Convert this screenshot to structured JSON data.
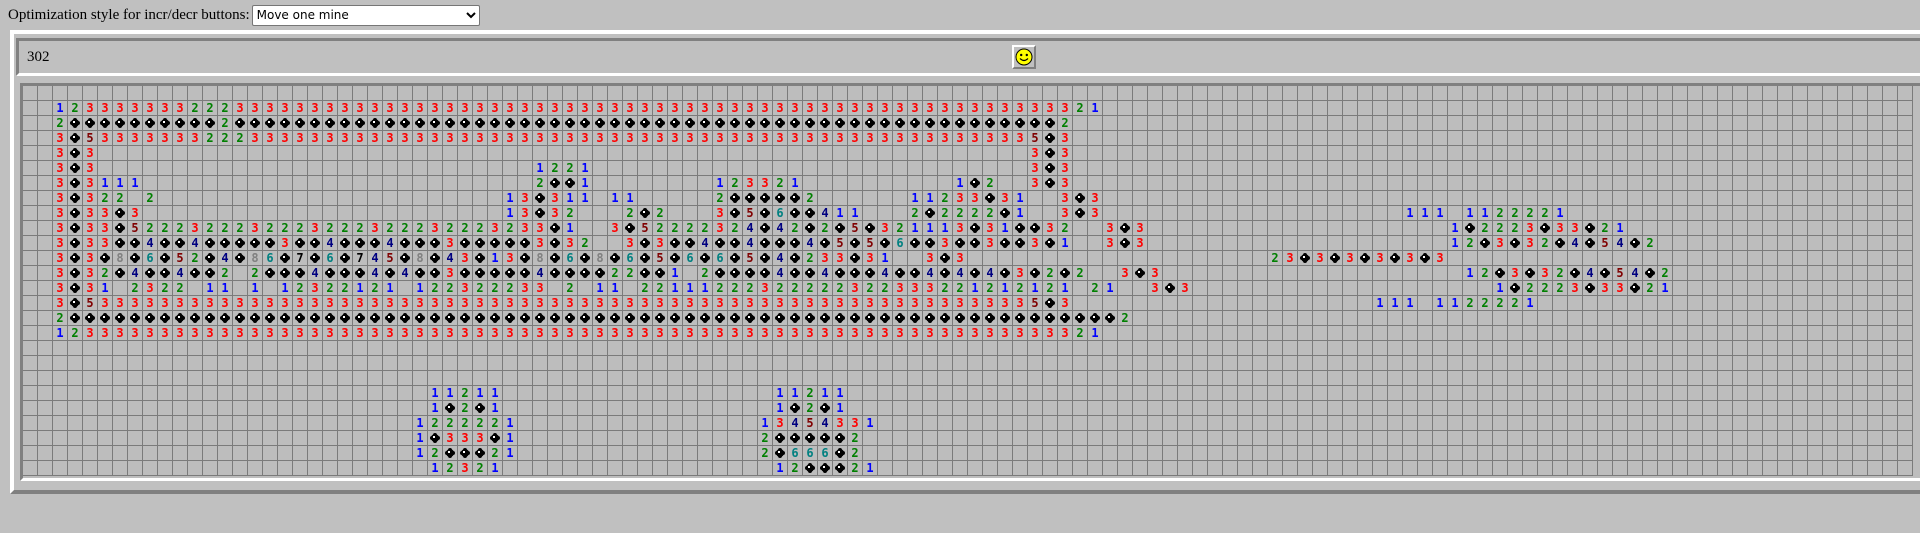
{
  "toolbar": {
    "label": "Optimization style for incr/decr buttons:",
    "selected_option": "Move one mine"
  },
  "header": {
    "mine_count": "302",
    "face": "smiley-face-icon"
  },
  "colors": {
    "1": "#0000ff",
    "2": "#008000",
    "3": "#ff0000",
    "4": "#000080",
    "5": "#800000",
    "6": "#008080",
    "7": "#000000",
    "8": "#808080"
  },
  "board": {
    "legend": "Rows list revealed cells only: '.' empty, digits = neighbor mine count, '*' = mine; first character = column 0",
    "rows": [
      "",
      "  1233333332223333333333333333333333333333333333333333333333333333333321",
      "  2**********2*******************************************************2",
      "  3*5333333322233333333333333333333333333333333333333333333333333335*3",
      "  3*3                                                              3*3",
      "  3*3                             1221                             3*3",
      "  3*3111                          2**1        123321          1*2  3*3",
      "  3*322 2                       13*311 11     2*****2      11233*31  3*3",
      "  3*33*3                        13*32   2*2   3*5*6**411   2*2222*1  3*3                    111 1122221",
      "  3*33*5222322232223222322232223233*1  3*52222324*42*2*5*321113*31**32  3*3                    1*2223*33*21",
      "  3*33**4**4*****3**4***4***3*****3*32  3*3**4**4***4*5*5*6**3**3**3*1  3*3                    12*3*32*4*54*2",
      "  3*3*8*6*52*4*86*7*6*745*8*43*13*8*6*8*6*5*6*6*5*4*233*31  3*3                    23*3*3*3*3*3",
      "  3*32*4**4**2 2***4***4*4**3*****4****22**1 2****4**4***4**4*4*4*3*2*2  3*3                    12*3*32*4*54*2",
      "  3*31 2322 11 1 12322121 122322233 2 11 22111222322222322333221212121 21  3*3                    1*2223*33*21",
      "  3*5333333333333333333333333333333333333333333333333333333333333335*3                    111 1122221",
      "  2**********************************************************************2",
      "  1233333333333333333333333333333333333333333333333333333333333333333321",
      "",
      "",
      "",
      "                           11211                  11211",
      "                           1*2*1                  1*2*1",
      "                          1222221                13454331",
      "                          1*333*1                2*****2",
      "                          12***21                2*666*2",
      "                           12321                  12***21",
      "                                                   12321"
    ]
  }
}
